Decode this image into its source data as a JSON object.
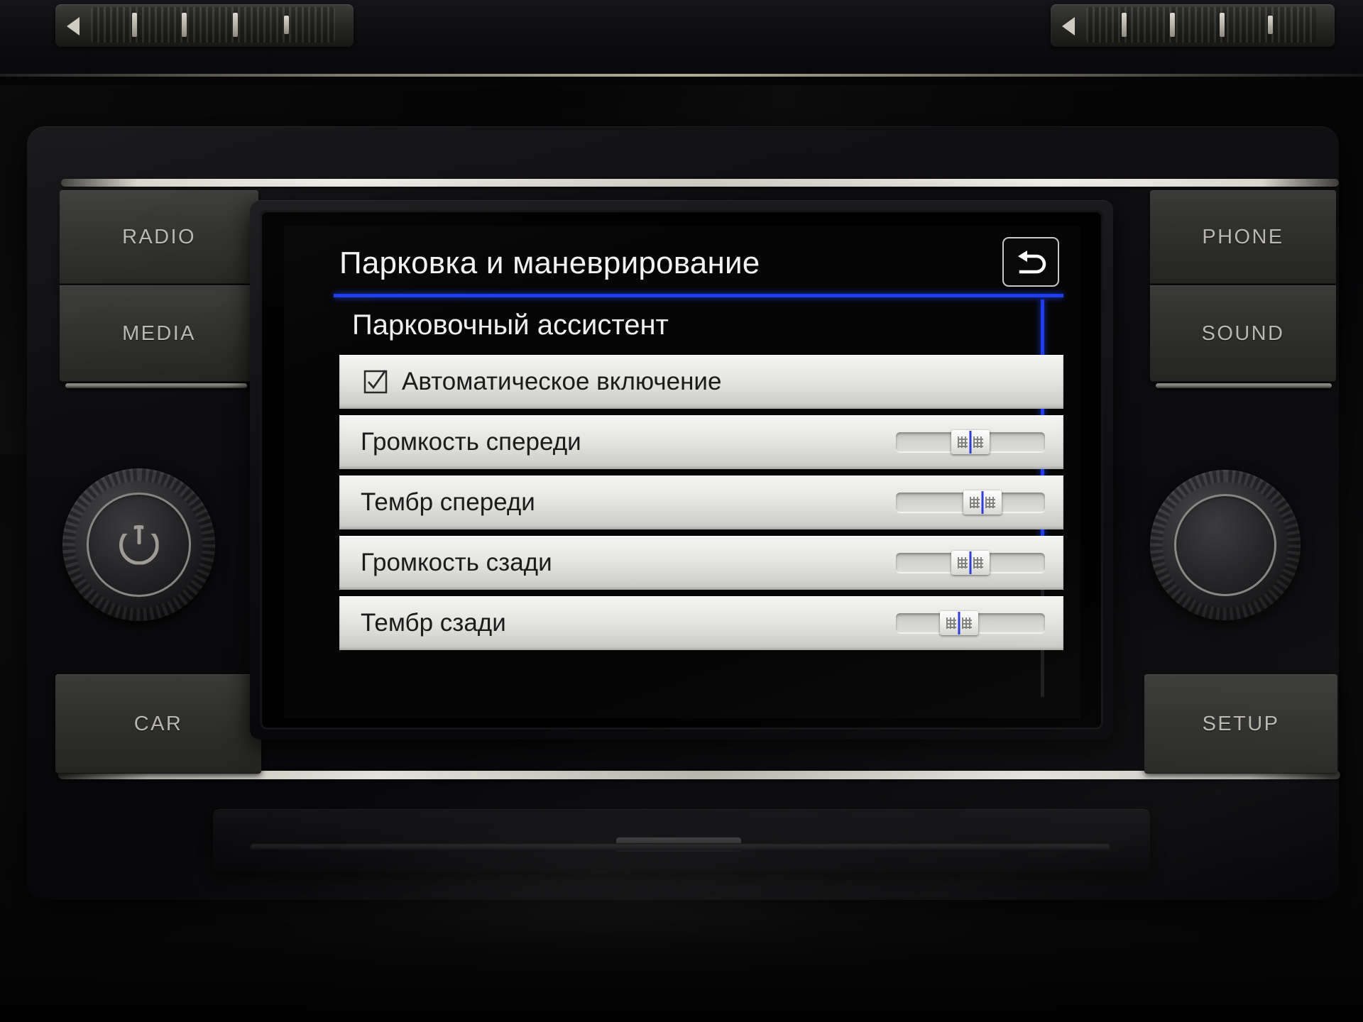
{
  "device": {
    "name": "Volkswagen Composition Media head unit",
    "hardware_buttons_left": [
      {
        "label": "RADIO",
        "name": "radio-button"
      },
      {
        "label": "MEDIA",
        "name": "media-button"
      },
      {
        "label": "CAR",
        "name": "car-button"
      }
    ],
    "hardware_buttons_right": [
      {
        "label": "PHONE",
        "name": "phone-button"
      },
      {
        "label": "SOUND",
        "name": "sound-button"
      },
      {
        "label": "SETUP",
        "name": "setup-button"
      }
    ],
    "knobs": [
      {
        "name": "power-volume-knob",
        "icon": "power-icon"
      },
      {
        "name": "tune-knob",
        "icon": "none"
      }
    ],
    "top_dials": [
      {
        "name": "left-vent-dial",
        "icon": "left-arrow-icon"
      },
      {
        "name": "right-vent-dial",
        "icon": "left-arrow-icon"
      }
    ]
  },
  "screen": {
    "title": "Парковка и маневрирование",
    "back_button_icon": "u-turn-back-arrow-icon",
    "accent_color": "#1e3df0",
    "section_header": "Парковочный ассистент",
    "rows": [
      {
        "type": "checkbox",
        "label": "Автоматическое включение",
        "checked": true,
        "icon": "checkbox-checked-icon"
      },
      {
        "type": "slider",
        "label": "Громкость спереди",
        "value_percent": 50
      },
      {
        "type": "slider",
        "label": "Тембр спереди",
        "value_percent": 58
      },
      {
        "type": "slider",
        "label": "Громкость сзади",
        "value_percent": 50
      },
      {
        "type": "slider",
        "label": "Тембр сзади",
        "value_percent": 43
      }
    ],
    "scrollbar": {
      "visible": true,
      "thumb_percent": 72,
      "position": "right"
    }
  }
}
